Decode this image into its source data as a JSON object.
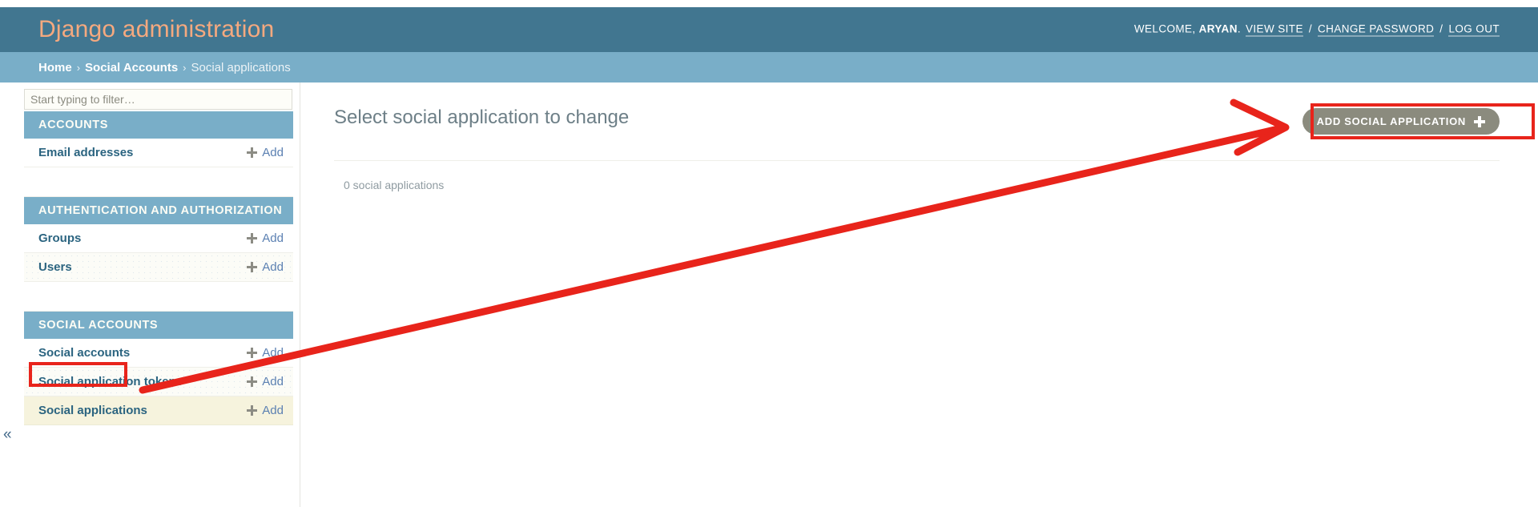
{
  "header": {
    "branding": "Django administration",
    "user_tools": {
      "welcome": "WELCOME,",
      "username": "ARYAN",
      "period": ".",
      "view_site": "VIEW SITE",
      "separator": "/",
      "change_password": "CHANGE PASSWORD",
      "log_out": "LOG OUT"
    }
  },
  "breadcrumbs": {
    "home": "Home",
    "sep": "›",
    "app": "Social Accounts",
    "current": "Social applications"
  },
  "sidebar": {
    "filter_placeholder": "Start typing to filter…",
    "filter_value": "",
    "collapse_icon": "«",
    "add_label": "Add",
    "apps": [
      {
        "caption": "ACCOUNTS",
        "models": [
          {
            "name": "Email addresses",
            "add": "Add",
            "striped": false,
            "selected": false
          }
        ]
      },
      {
        "caption": "AUTHENTICATION AND AUTHORIZATION",
        "models": [
          {
            "name": "Groups",
            "add": "Add",
            "striped": false,
            "selected": false
          },
          {
            "name": "Users",
            "add": "Add",
            "striped": true,
            "selected": false
          }
        ]
      },
      {
        "caption": "SOCIAL ACCOUNTS",
        "models": [
          {
            "name": "Social accounts",
            "add": "Add",
            "striped": false,
            "selected": false
          },
          {
            "name": "Social application tokens",
            "add": "Add",
            "striped": true,
            "selected": false
          },
          {
            "name": "Social applications",
            "add": "Add",
            "striped": false,
            "selected": true
          }
        ]
      }
    ]
  },
  "content": {
    "title": "Select social application to change",
    "add_button": "ADD SOCIAL APPLICATION",
    "result_count": "0 social applications"
  },
  "colors": {
    "header_bg": "#417690",
    "breadcrumb_bg": "#79aec8",
    "branding_text": "#f5a97f",
    "section_header_bg": "#79aec8",
    "selected_row_bg": "#f6f3dd",
    "add_button_bg": "#8b8b7e",
    "annotation_red": "#e8241b",
    "model_link": "#2b6480"
  }
}
